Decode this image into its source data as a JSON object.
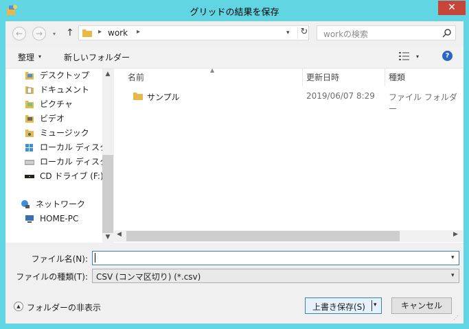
{
  "window": {
    "title": "グリッドの結果を保存",
    "close_label": "✕"
  },
  "nav": {
    "back": "←",
    "forward": "→",
    "dropdown": "▾",
    "up": "↑",
    "address_sep": "▸",
    "address_path": "work",
    "refresh": "↻",
    "search_placeholder": "workの検索"
  },
  "toolbar": {
    "organize": "整理",
    "new_folder": "新しいフォルダー",
    "help": "?"
  },
  "sidebar": {
    "items": [
      {
        "label": "デスクトップ",
        "icon": "folder-icon"
      },
      {
        "label": "ドキュメント",
        "icon": "documents-icon"
      },
      {
        "label": "ピクチャ",
        "icon": "pictures-icon"
      },
      {
        "label": "ビデオ",
        "icon": "videos-icon"
      },
      {
        "label": "ミュージック",
        "icon": "music-icon"
      },
      {
        "label": "ローカル ディスク (C",
        "icon": "drive-c-icon"
      },
      {
        "label": "ローカル ディスク (D",
        "icon": "drive-d-icon"
      },
      {
        "label": "CD ドライブ (F:) S",
        "icon": "cd-drive-icon"
      },
      {
        "label": "ネットワーク",
        "icon": "network-icon"
      },
      {
        "label": "HOME-PC",
        "icon": "computer-icon"
      }
    ]
  },
  "columns": {
    "name": "名前",
    "modified": "更新日時",
    "type": "種類"
  },
  "files": [
    {
      "name": "サンプル",
      "modified": "2019/06/07 8:29",
      "type": "ファイル フォルダー"
    }
  ],
  "fields": {
    "filename_label": "ファイル名(N):",
    "filename_value": "",
    "filetype_label": "ファイルの種類(T):",
    "filetype_value": "CSV (コンマ区切り) (*.csv)"
  },
  "footer": {
    "hide_folders": "フォルダーの非表示",
    "save": "上書き保存(S)",
    "cancel": "キャンセル"
  },
  "colors": {
    "accent": "#61d5e2",
    "close": "#c7463a",
    "folder": "#e8b84a"
  }
}
